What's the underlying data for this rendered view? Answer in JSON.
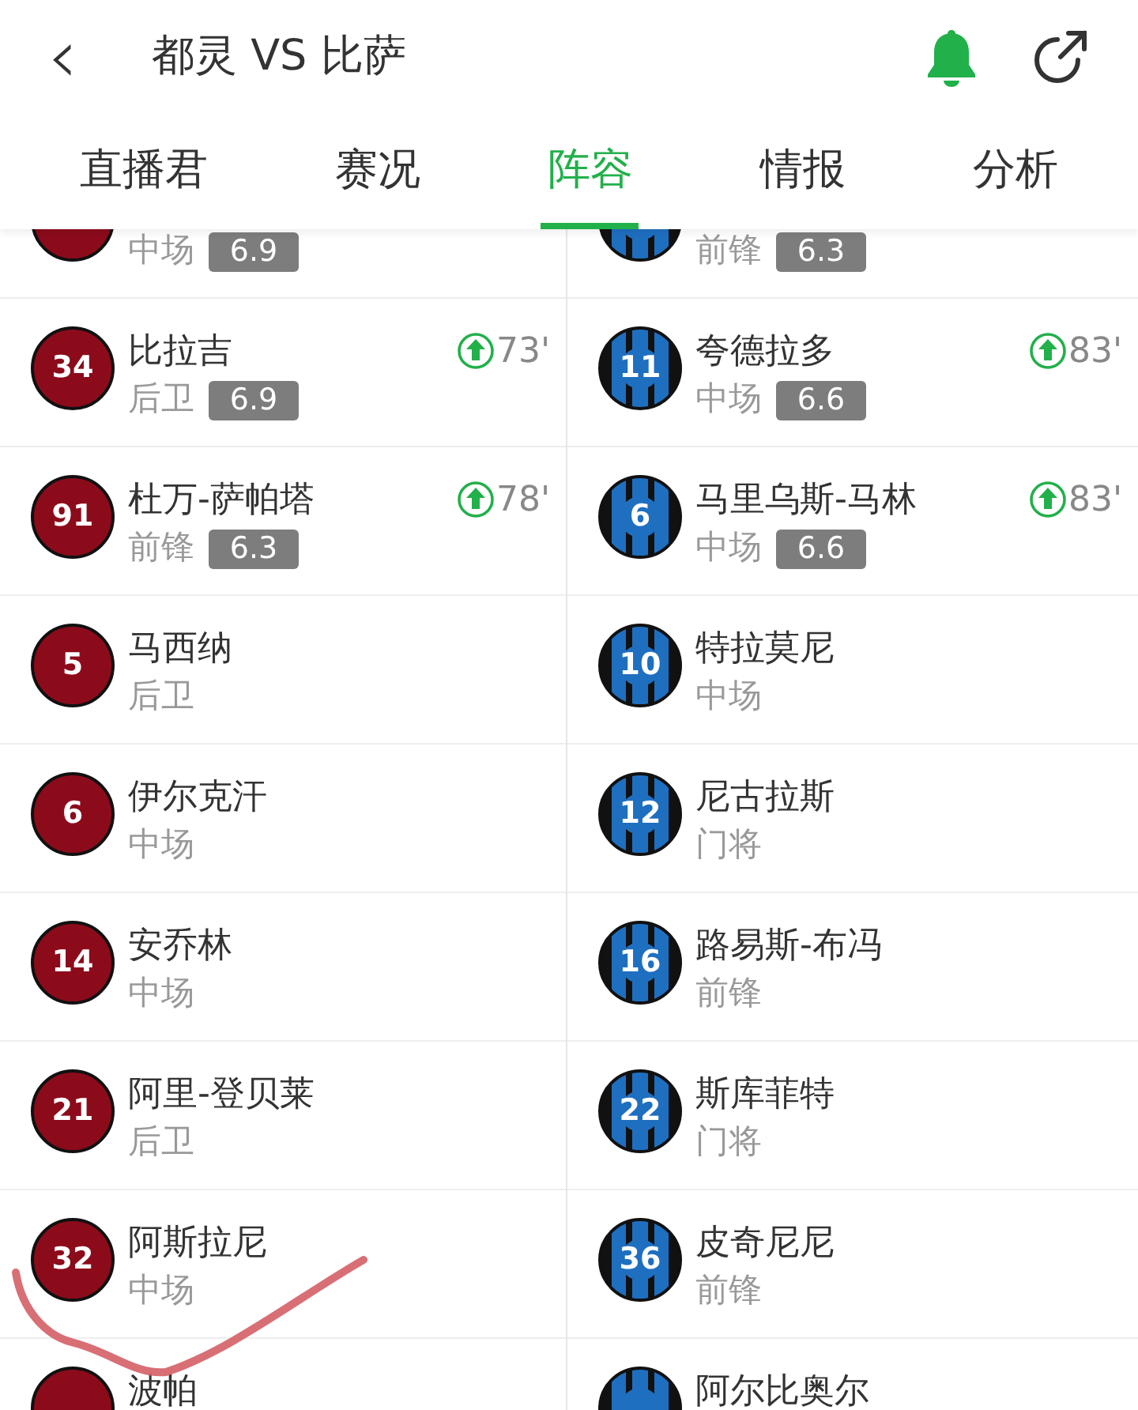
{
  "header": {
    "back": "‹",
    "title": "都灵 VS 比萨",
    "bell_on": true
  },
  "tabs": [
    {
      "label": "直播君",
      "selected": false
    },
    {
      "label": "赛况",
      "selected": false
    },
    {
      "label": "阵容",
      "selected": true
    },
    {
      "label": "情报",
      "selected": false
    },
    {
      "label": "分析",
      "selected": false
    }
  ],
  "teams": [
    {
      "kind": "solid",
      "players": [
        {
          "position": "中场",
          "rating": "6.9"
        },
        {
          "number": "34",
          "name": "比拉吉",
          "position": "后卫",
          "rating": "6.9",
          "sub_in": "73'"
        },
        {
          "number": "91",
          "name": "杜万-萨帕塔",
          "position": "前锋",
          "rating": "6.3",
          "sub_in": "78'"
        },
        {
          "number": "5",
          "name": "马西纳",
          "position": "后卫"
        },
        {
          "number": "6",
          "name": "伊尔克汗",
          "position": "中场"
        },
        {
          "number": "14",
          "name": "安乔林",
          "position": "中场"
        },
        {
          "number": "21",
          "name": "阿里-登贝莱",
          "position": "后卫"
        },
        {
          "number": "32",
          "name": "阿斯拉尼",
          "position": "中场"
        },
        {
          "name": "波帕"
        }
      ]
    },
    {
      "kind": "stripes",
      "players": [
        {
          "position": "前锋",
          "rating": "6.3"
        },
        {
          "number": "11",
          "name": "夸德拉多",
          "position": "中场",
          "rating": "6.6",
          "sub_in": "83'"
        },
        {
          "number": "6",
          "name": "马里乌斯-马林",
          "position": "中场",
          "rating": "6.6",
          "sub_in": "83'"
        },
        {
          "number": "10",
          "name": "特拉莫尼",
          "position": "中场"
        },
        {
          "number": "12",
          "name": "尼古拉斯",
          "position": "门将"
        },
        {
          "number": "16",
          "name": "路易斯-布冯",
          "position": "前锋"
        },
        {
          "number": "22",
          "name": "斯库菲特",
          "position": "门将"
        },
        {
          "number": "36",
          "name": "皮奇尼尼",
          "position": "前锋"
        },
        {
          "name": "阿尔比奥尔"
        }
      ]
    }
  ],
  "annotation": {
    "kind": "stroke"
  }
}
